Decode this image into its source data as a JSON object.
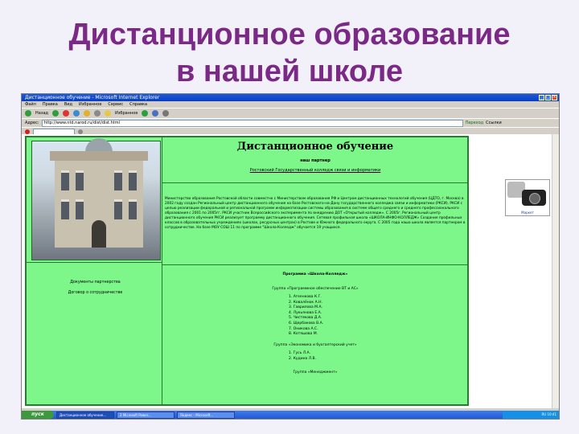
{
  "slide": {
    "title_line1": "Дистанционное образование",
    "title_line2": "в нашей школе"
  },
  "browser": {
    "window_title": "Дистанционное обучение - Microsoft Internet Explorer",
    "menu": [
      "Файл",
      "Правка",
      "Вид",
      "Избранное",
      "Сервис",
      "Справка"
    ],
    "toolbar": {
      "back": "Назад",
      "favorites": "Избранное"
    },
    "address": {
      "label": "Адрес:",
      "url": "http://www.ntd.narod.ru/dist/dist.html",
      "go": "Переход"
    },
    "links_label": "Ссылки"
  },
  "webpage": {
    "heading": "Дистанционное обучение",
    "partner_label": "наш партнер",
    "partner_name": "Ростовский Государственный колледж связи и информатики",
    "paragraph": "Министерство образования Ростовской области совместно с Министерством образования РФ и Центром дистанционных технологий обучения (ЦДТО, г. Москва) в 2002 году создан Региональный центр дистанционного обучения на базе Ростовского-на-Дону государственного колледжа связи и информатики (РКСИ). РКСИ с целью реализации федеральной и региональной программ информатизации системы образования в системе общего среднего и среднего профессионального образования с 2001 по 2005гг. РКСИ участник Всероссийского эксперимента по внедрению ДОТ «Открытый колледж». С 2005г. Региональный центр дистанционного обучения РКСИ реализует программу дистанционного обучения. Сетевая профильная школа «ШКОЛА-ИНФО-КОЛЛЕДЖ» Создание профильных классов в образовательных учреждениях (школах, ресурсных центрах) в Ростове и Южного федерального округа. С 2005 года наша школа является партнером в сотрудничестве. На базе МОУ СОШ 11 по программе \"Школа-Колледж\" обучается 19 учащихся.",
    "left_link_1": "Документы партнерства",
    "left_link_2": "Договор о сотрудничестве",
    "program_title": "Программа «Школа-Колледж»",
    "group1_title": "Группа «Программное обеспечение ВТ и АС»",
    "group1_list": [
      "1. Агеенкова К.Г.",
      "2. Ковалёнок А.Н.",
      "3. Гаврилова М.А.",
      "4. Лукьянова Е.А.",
      "5. Чистякова Д.А.",
      "6. Щербакова В.А.",
      "7. Оникова А.С.",
      "8. Котяшова М."
    ],
    "group2_title": "Группа «Экономика и бухгалтерский учет»",
    "group2_list": [
      "1. Гусь Л.А.",
      "2. Кудина Л.В."
    ],
    "group3_title": "Группа «Менеджмент»",
    "ad_label": "Маркет"
  },
  "taskbar": {
    "start": "пуск",
    "tasks": [
      "Дистанционное обучение...",
      "2 Microsoft Power...",
      "Яндекс - Microsoft..."
    ],
    "clock": "RU 10:41"
  }
}
